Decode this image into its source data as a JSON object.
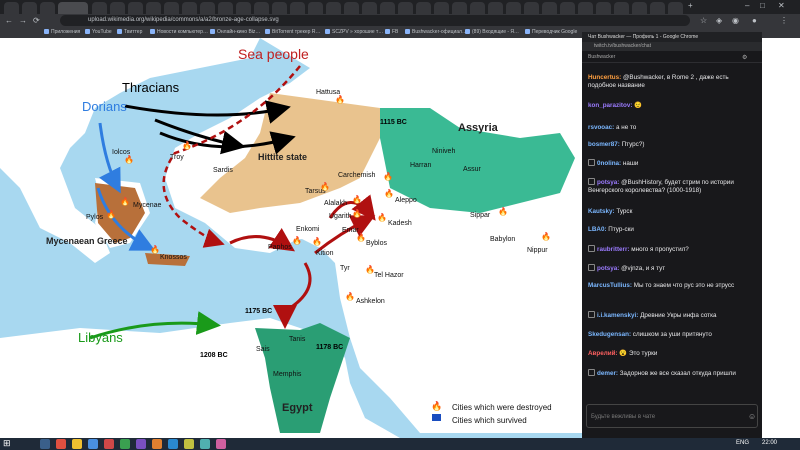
{
  "browser": {
    "url": "upload.wikimedia.org/wikipedia/commons/a/a2/bronze-age-collapse.svg",
    "bookmarks": [
      "Приложения",
      "YouTube",
      "Твиттер",
      "Новости компьютер…",
      "Онлайн-кино Biz…",
      "BitTorrent трекер R…",
      "SCZPV » хорошие т…",
      "FB",
      "Bushwacker-официал…",
      "(89) Входящие - Я…",
      "Переводчик Google"
    ]
  },
  "map": {
    "title_region": "Sea people",
    "peoples": {
      "thracians": "Thracians",
      "dorians": "Dorians",
      "libyans": "Libyans"
    },
    "regions": {
      "hittite": "Hittite state",
      "mycenaean": "Mycenaean Greece",
      "assyria": "Assyria",
      "egypt": "Egypt"
    },
    "cities": [
      "Hattusa",
      "Iolcos",
      "Troy",
      "Sardis",
      "Mycenae",
      "Pylos",
      "Knossos",
      "Tarsus",
      "Carchemish",
      "Alalakh",
      "Aleppo",
      "Ugarith",
      "Emar",
      "Niniveh",
      "Harran",
      "Assur",
      "Kadesh",
      "Enkomi",
      "Paphos",
      "Kition",
      "Byblos",
      "Tyr",
      "Tel Hazor",
      "Ashkelon",
      "Sippar",
      "Babylon",
      "Nippur",
      "Sais",
      "Tanis",
      "Memphis"
    ],
    "dates": {
      "d1115": "1115 BC",
      "d1175": "1175 BC",
      "d1178": "1178 BC",
      "d1208": "1208 BC"
    },
    "legend": {
      "destroyed": "Cities which were destroyed",
      "survived": "Cities which survived"
    },
    "colors": {
      "sea": "#a8d8f0",
      "land": "#ffffff",
      "hittite": "#e8c088",
      "mycenaean": "#b8703a",
      "assyria": "#3aba94",
      "egypt": "#2a9e74"
    }
  },
  "chat": {
    "window_title": "Чат Bushwacker — Профиль 1 - Google Chrome",
    "window_url": "twitch.tv/bushwacker/chat",
    "header": "Bushwacker",
    "messages": [
      {
        "user": "Huncertus:",
        "text": "@Bushwacker, в Rome 2 , даже есть подобное название",
        "color": "#ff9f40"
      },
      {
        "user": "kon_parazitov:",
        "text": "😟",
        "color": "#9b7bff"
      },
      {
        "user": "rsvooac:",
        "text": "а не то",
        "color": "#7bb7ff"
      },
      {
        "user": "bosmer87:",
        "text": "Птурс?)",
        "color": "#7bb7ff"
      },
      {
        "user": "0nolina:",
        "text": "наши",
        "color": "#7bb7ff"
      },
      {
        "user": "potsya:",
        "text": "@BushHistory, будет стрим по истории Венгерского королевства? (1000-1918)",
        "color": "#9b7bff"
      },
      {
        "user": "Kautsky:",
        "text": "Турск",
        "color": "#7bb7ff"
      },
      {
        "user": "LBA0:",
        "text": "Птур-ски",
        "color": "#7bb7ff"
      },
      {
        "user": "raubritterr:",
        "text": "много я пропустил?",
        "color": "#9b7bff"
      },
      {
        "user": "potsya:",
        "text": "@vjnza, и я тут",
        "color": "#9b7bff"
      },
      {
        "user": "MarcusTullius:",
        "text": "Мы то знаем что рус это не этрусс",
        "color": "#7bb7ff"
      },
      {
        "user": "i.i.kamenskyi:",
        "text": "Древние Укры инфа сотка",
        "color": "#7bb7ff"
      },
      {
        "user": "Skedugensan:",
        "text": "слишком за уши притянуто",
        "color": "#7bb7ff"
      },
      {
        "user": "Аврелий:",
        "text": "😮 Это турки",
        "color": "#ff6060"
      },
      {
        "user": "demer:",
        "text": "Задорнов же все сказал откуда пришли",
        "color": "#7bb7ff"
      }
    ],
    "input_placeholder": "Будьте вежливы в чате"
  },
  "taskbar": {
    "lang": "ENG",
    "time": "22:00"
  }
}
